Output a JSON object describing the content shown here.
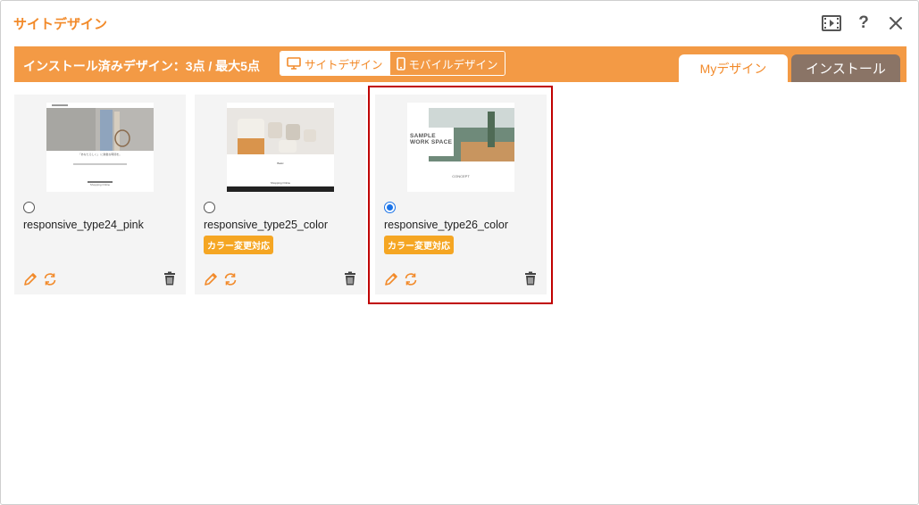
{
  "dialog": {
    "title": "サイトデザイン",
    "header_icons": [
      "video-icon",
      "help-icon",
      "close-icon"
    ],
    "help_label": "?"
  },
  "toolbar": {
    "installed_count": "インストール済みデザイン：3点 / 最大5点",
    "site_design_label": "サイトデザイン",
    "mobile_design_label": "モバイルデザイン",
    "tab_my": "Myデザイン",
    "tab_install": "インストール"
  },
  "colors": {
    "accent": "#f28a2a",
    "bar": "#f39a45",
    "badge": "#f5a623",
    "install_tab": "#8a7466",
    "selection_border": "#c00000",
    "radio_checked": "#1a73e8"
  },
  "designs": [
    {
      "name": "responsive_type24_pink",
      "selected": false,
      "badge": "",
      "thumb_caption": "「あなたらしく」 に素敵な時間を。",
      "thumb_button": "Shopping Online"
    },
    {
      "name": "responsive_type25_color",
      "selected": false,
      "badge": "カラー変更対応",
      "thumb_caption": "Basic",
      "thumb_button": "Shopping Online"
    },
    {
      "name": "responsive_type26_color",
      "selected": true,
      "badge": "カラー変更対応",
      "thumb_heading": "SAMPLE WORK SPACE",
      "thumb_caption": "CONCEPT"
    }
  ]
}
